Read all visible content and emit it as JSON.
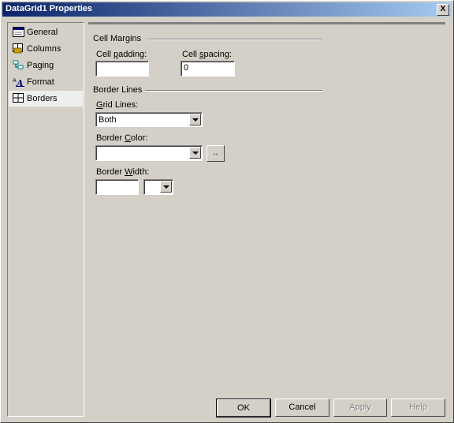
{
  "window": {
    "title": "DataGrid1 Properties",
    "close_label": "X"
  },
  "nav": {
    "items": [
      {
        "label": "General",
        "icon": "general-icon"
      },
      {
        "label": "Columns",
        "icon": "columns-icon"
      },
      {
        "label": "Paging",
        "icon": "paging-icon"
      },
      {
        "label": "Format",
        "icon": "format-icon"
      },
      {
        "label": "Borders",
        "icon": "borders-icon",
        "selected": true
      }
    ]
  },
  "cell_margins": {
    "title": "Cell Margins",
    "padding_label_pre": "Cell ",
    "padding_label_ul": "p",
    "padding_label_post": "adding:",
    "padding_value": "",
    "spacing_label_pre": "Cell ",
    "spacing_label_ul": "s",
    "spacing_label_post": "pacing:",
    "spacing_value": "0"
  },
  "border_lines": {
    "title": "Border Lines",
    "grid_label_ul": "G",
    "grid_label_post": "rid Lines:",
    "grid_value": "Both",
    "color_label_pre": "Border ",
    "color_label_ul": "C",
    "color_label_post": "olor:",
    "color_value": "",
    "color_browse_label": "..",
    "width_label_pre": "Border ",
    "width_label_ul": "W",
    "width_label_post": "idth:",
    "width_value": "",
    "width_unit_value": ""
  },
  "buttons": {
    "ok": "OK",
    "cancel": "Cancel",
    "apply": "Apply",
    "help": "Help"
  }
}
